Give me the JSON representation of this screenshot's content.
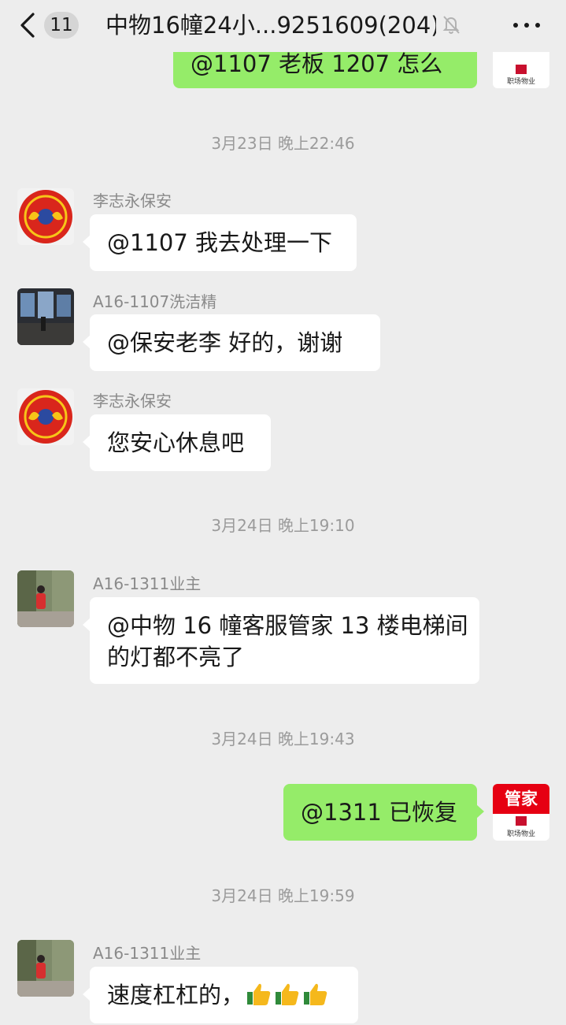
{
  "header": {
    "unread_count": "11",
    "title": "中物16幢24小...9251609(204)"
  },
  "messages": [
    {
      "id": "m0",
      "side": "right",
      "text": "@1107  老板 1207 怎么啦"
    },
    {
      "id": "t1",
      "type": "time",
      "text": "3月23日 晚上22:46"
    },
    {
      "id": "m1",
      "side": "left",
      "sender": "李志永保安",
      "text": "@1107  我去处理一下"
    },
    {
      "id": "m2",
      "side": "left",
      "sender": "A16-1107洗洁精",
      "text": "@保安老李  好的，谢谢"
    },
    {
      "id": "m3",
      "side": "left",
      "sender": "李志永保安",
      "text": "您安心休息吧"
    },
    {
      "id": "t2",
      "type": "time",
      "text": "3月24日 晚上19:10"
    },
    {
      "id": "m4",
      "side": "left",
      "sender": "A16-1311业主",
      "line1": "@中物 16 幢客服管家  13 楼电梯间",
      "line2": "的灯都不亮了"
    },
    {
      "id": "t3",
      "type": "time",
      "text": "3月24日 晚上19:43"
    },
    {
      "id": "m5",
      "side": "right",
      "text": "@1311  已恢复"
    },
    {
      "id": "t4",
      "type": "time",
      "text": "3月24日 晚上19:59"
    },
    {
      "id": "m6",
      "side": "left",
      "sender": "A16-1311业主",
      "text": "速度杠杠的，"
    }
  ],
  "self_avatar": {
    "badge_text": "管家",
    "brand_text": "职场物业"
  },
  "colors": {
    "background": "#ededed",
    "self_bubble": "#95ec69",
    "other_bubble": "#ffffff",
    "brand_red": "#e60012"
  }
}
